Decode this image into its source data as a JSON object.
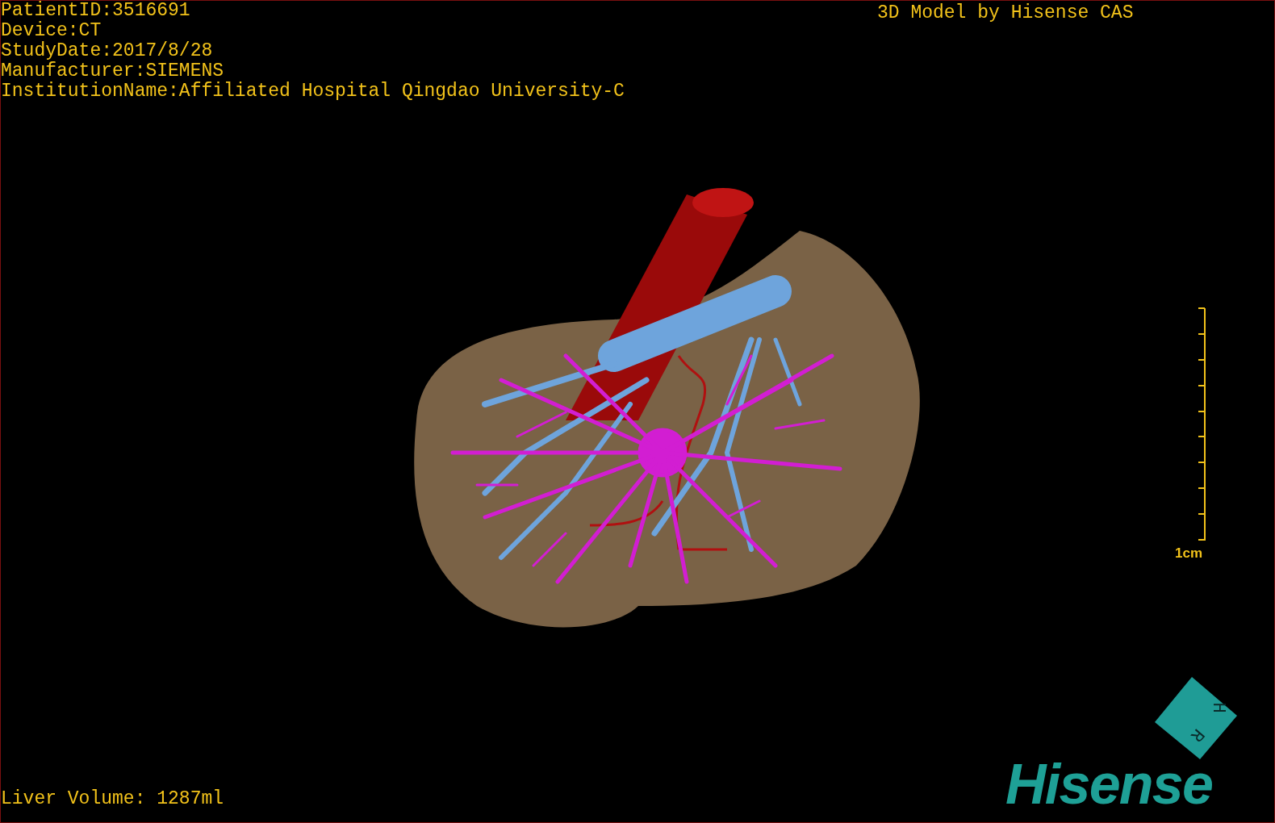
{
  "study_info": [
    "PatientID:3516691",
    "Device:CT",
    "StudyDate:2017/8/28",
    "Manufacturer:SIEMENS",
    "InstitutionName:Affiliated Hospital Qingdao University-C"
  ],
  "header_right": "3D Model by Hisense CAS",
  "scale_bar": {
    "label": "1cm"
  },
  "orientation_cube": {
    "labels": [
      "H",
      "R"
    ]
  },
  "logo": "Hisense",
  "liver_volume": "Liver Volume: 1287ml"
}
